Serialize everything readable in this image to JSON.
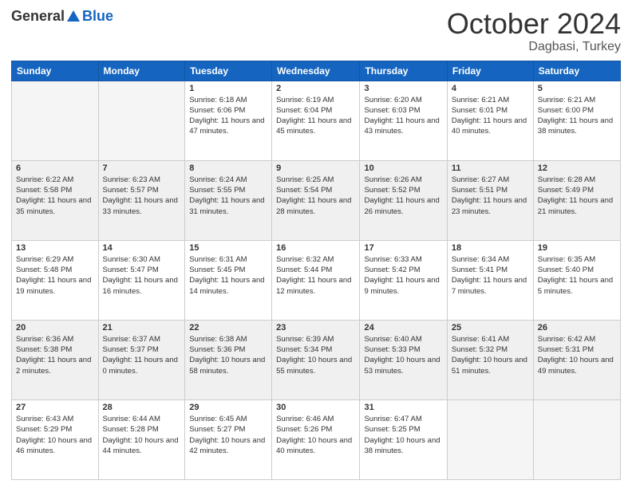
{
  "header": {
    "logo_general": "General",
    "logo_blue": "Blue",
    "month_title": "October 2024",
    "location": "Dagbasi, Turkey"
  },
  "weekdays": [
    "Sunday",
    "Monday",
    "Tuesday",
    "Wednesday",
    "Thursday",
    "Friday",
    "Saturday"
  ],
  "weeks": [
    [
      {
        "day": "",
        "info": ""
      },
      {
        "day": "",
        "info": ""
      },
      {
        "day": "1",
        "info": "Sunrise: 6:18 AM\nSunset: 6:06 PM\nDaylight: 11 hours and 47 minutes."
      },
      {
        "day": "2",
        "info": "Sunrise: 6:19 AM\nSunset: 6:04 PM\nDaylight: 11 hours and 45 minutes."
      },
      {
        "day": "3",
        "info": "Sunrise: 6:20 AM\nSunset: 6:03 PM\nDaylight: 11 hours and 43 minutes."
      },
      {
        "day": "4",
        "info": "Sunrise: 6:21 AM\nSunset: 6:01 PM\nDaylight: 11 hours and 40 minutes."
      },
      {
        "day": "5",
        "info": "Sunrise: 6:21 AM\nSunset: 6:00 PM\nDaylight: 11 hours and 38 minutes."
      }
    ],
    [
      {
        "day": "6",
        "info": "Sunrise: 6:22 AM\nSunset: 5:58 PM\nDaylight: 11 hours and 35 minutes."
      },
      {
        "day": "7",
        "info": "Sunrise: 6:23 AM\nSunset: 5:57 PM\nDaylight: 11 hours and 33 minutes."
      },
      {
        "day": "8",
        "info": "Sunrise: 6:24 AM\nSunset: 5:55 PM\nDaylight: 11 hours and 31 minutes."
      },
      {
        "day": "9",
        "info": "Sunrise: 6:25 AM\nSunset: 5:54 PM\nDaylight: 11 hours and 28 minutes."
      },
      {
        "day": "10",
        "info": "Sunrise: 6:26 AM\nSunset: 5:52 PM\nDaylight: 11 hours and 26 minutes."
      },
      {
        "day": "11",
        "info": "Sunrise: 6:27 AM\nSunset: 5:51 PM\nDaylight: 11 hours and 23 minutes."
      },
      {
        "day": "12",
        "info": "Sunrise: 6:28 AM\nSunset: 5:49 PM\nDaylight: 11 hours and 21 minutes."
      }
    ],
    [
      {
        "day": "13",
        "info": "Sunrise: 6:29 AM\nSunset: 5:48 PM\nDaylight: 11 hours and 19 minutes."
      },
      {
        "day": "14",
        "info": "Sunrise: 6:30 AM\nSunset: 5:47 PM\nDaylight: 11 hours and 16 minutes."
      },
      {
        "day": "15",
        "info": "Sunrise: 6:31 AM\nSunset: 5:45 PM\nDaylight: 11 hours and 14 minutes."
      },
      {
        "day": "16",
        "info": "Sunrise: 6:32 AM\nSunset: 5:44 PM\nDaylight: 11 hours and 12 minutes."
      },
      {
        "day": "17",
        "info": "Sunrise: 6:33 AM\nSunset: 5:42 PM\nDaylight: 11 hours and 9 minutes."
      },
      {
        "day": "18",
        "info": "Sunrise: 6:34 AM\nSunset: 5:41 PM\nDaylight: 11 hours and 7 minutes."
      },
      {
        "day": "19",
        "info": "Sunrise: 6:35 AM\nSunset: 5:40 PM\nDaylight: 11 hours and 5 minutes."
      }
    ],
    [
      {
        "day": "20",
        "info": "Sunrise: 6:36 AM\nSunset: 5:38 PM\nDaylight: 11 hours and 2 minutes."
      },
      {
        "day": "21",
        "info": "Sunrise: 6:37 AM\nSunset: 5:37 PM\nDaylight: 11 hours and 0 minutes."
      },
      {
        "day": "22",
        "info": "Sunrise: 6:38 AM\nSunset: 5:36 PM\nDaylight: 10 hours and 58 minutes."
      },
      {
        "day": "23",
        "info": "Sunrise: 6:39 AM\nSunset: 5:34 PM\nDaylight: 10 hours and 55 minutes."
      },
      {
        "day": "24",
        "info": "Sunrise: 6:40 AM\nSunset: 5:33 PM\nDaylight: 10 hours and 53 minutes."
      },
      {
        "day": "25",
        "info": "Sunrise: 6:41 AM\nSunset: 5:32 PM\nDaylight: 10 hours and 51 minutes."
      },
      {
        "day": "26",
        "info": "Sunrise: 6:42 AM\nSunset: 5:31 PM\nDaylight: 10 hours and 49 minutes."
      }
    ],
    [
      {
        "day": "27",
        "info": "Sunrise: 6:43 AM\nSunset: 5:29 PM\nDaylight: 10 hours and 46 minutes."
      },
      {
        "day": "28",
        "info": "Sunrise: 6:44 AM\nSunset: 5:28 PM\nDaylight: 10 hours and 44 minutes."
      },
      {
        "day": "29",
        "info": "Sunrise: 6:45 AM\nSunset: 5:27 PM\nDaylight: 10 hours and 42 minutes."
      },
      {
        "day": "30",
        "info": "Sunrise: 6:46 AM\nSunset: 5:26 PM\nDaylight: 10 hours and 40 minutes."
      },
      {
        "day": "31",
        "info": "Sunrise: 6:47 AM\nSunset: 5:25 PM\nDaylight: 10 hours and 38 minutes."
      },
      {
        "day": "",
        "info": ""
      },
      {
        "day": "",
        "info": ""
      }
    ]
  ]
}
